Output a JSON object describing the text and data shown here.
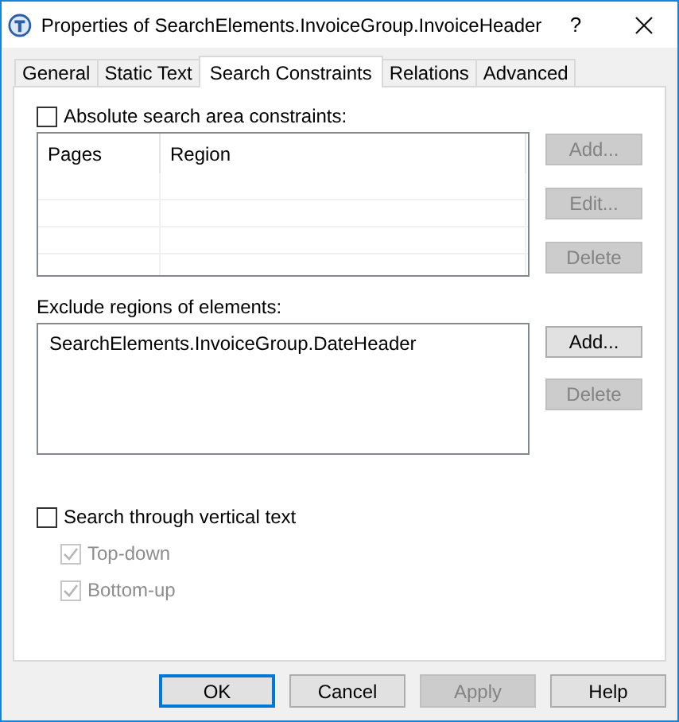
{
  "window": {
    "title": "Properties of SearchElements.InvoiceGroup.InvoiceHeader",
    "help": "?"
  },
  "tabs": [
    {
      "label": "General",
      "selected": false
    },
    {
      "label": "Static Text",
      "selected": false
    },
    {
      "label": "Search Constraints",
      "selected": true
    },
    {
      "label": "Relations",
      "selected": false
    },
    {
      "label": "Advanced",
      "selected": false
    }
  ],
  "absolute_constraints": {
    "label": "Absolute search area constraints:",
    "checked": false,
    "table": {
      "columns": [
        "Pages",
        "Region"
      ]
    },
    "buttons": [
      {
        "label": "Add...",
        "disabled": true
      },
      {
        "label": "Edit...",
        "disabled": true
      },
      {
        "label": "Delete",
        "disabled": true
      }
    ]
  },
  "exclude_regions": {
    "label": "Exclude regions of elements:",
    "items": [
      "SearchElements.InvoiceGroup.DateHeader"
    ],
    "buttons": [
      {
        "label": "Add...",
        "disabled": false
      },
      {
        "label": "Delete",
        "disabled": true
      }
    ]
  },
  "vertical_text": {
    "label": "Search through vertical text",
    "checked": false,
    "options": [
      {
        "label": "Top-down",
        "checked": true,
        "disabled": true
      },
      {
        "label": "Bottom-up",
        "checked": true,
        "disabled": true
      }
    ]
  },
  "footer_buttons": [
    {
      "label": "OK",
      "default": true,
      "disabled": false
    },
    {
      "label": "Cancel",
      "default": false,
      "disabled": false
    },
    {
      "label": "Apply",
      "default": false,
      "disabled": true
    },
    {
      "label": "Help",
      "default": false,
      "disabled": false
    }
  ]
}
